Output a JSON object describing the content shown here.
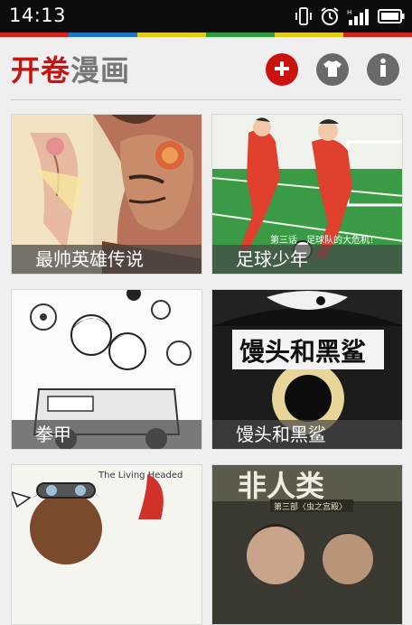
{
  "status_bar": {
    "time": "14:13",
    "icons": [
      "vibrate-icon",
      "alarm-icon",
      "signal-icon",
      "battery-icon"
    ]
  },
  "colors": {
    "rainbow": [
      "#d4241c",
      "#1b74c4",
      "#e8c817",
      "#2e9e3c",
      "#e8c817",
      "#d4241c"
    ],
    "brand_red": "#cc1111",
    "icon_grey": "#6a6a6a"
  },
  "header": {
    "logo_red": "开卷",
    "logo_grey": "漫画",
    "actions": [
      {
        "name": "add-button",
        "icon": "plus-icon",
        "symbol": "+",
        "color": "#cc1111"
      },
      {
        "name": "theme-button",
        "icon": "tshirt-icon",
        "symbol": "",
        "color": "#6a6a6a"
      },
      {
        "name": "info-button",
        "icon": "info-icon",
        "symbol": "i",
        "color": "#6a6a6a"
      }
    ]
  },
  "comics": [
    {
      "title": "最帅英雄传说"
    },
    {
      "title": "足球少年",
      "cover_text": "第三话　足球队的大危机！"
    },
    {
      "title": "拳甲"
    },
    {
      "title": "馒头和黑鲨",
      "cover_title": "馒头和黑鲨"
    },
    {
      "title": "",
      "cover_text": "The Living Headed"
    },
    {
      "title": "",
      "cover_title": "非人类",
      "cover_text": "第三部〈虫之宫殿〉"
    }
  ]
}
